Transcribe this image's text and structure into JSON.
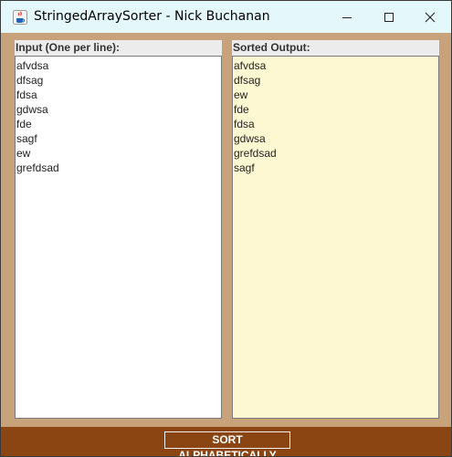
{
  "window": {
    "title": "StringedArraySorter - Nick Buchanan",
    "icon": "java-cup-icon"
  },
  "input_panel": {
    "label": "Input (One per line):",
    "lines": [
      "afvdsa",
      "dfsag",
      "fdsa",
      "gdwsa",
      "fde",
      "sagf",
      "ew",
      "grefdsad"
    ]
  },
  "output_panel": {
    "label": "Sorted Output:",
    "lines": [
      "afvdsa",
      "dfsag",
      "ew",
      "fde",
      "fdsa",
      "gdwsa",
      "grefdsad",
      "sagf"
    ]
  },
  "actions": {
    "sort_label": "SORT ALPHABETICALLY"
  },
  "colors": {
    "frame": "#c8a27a",
    "bottom_bar": "#8b4513",
    "output_bg": "#fef8d2",
    "titlebar": "#e4f7fb"
  }
}
